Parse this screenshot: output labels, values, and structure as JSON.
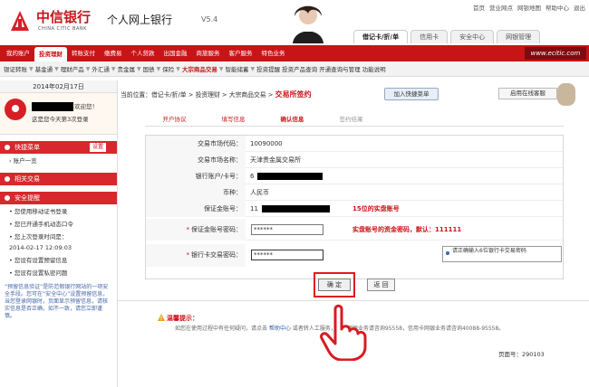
{
  "header": {
    "logo_cn": "中信银行",
    "logo_en": "CHINA CITIC BANK",
    "title": "个人网上银行",
    "version": "V5.4",
    "top_links": [
      "首页",
      "营业网点",
      "网银地图",
      "帮助中心",
      "退出"
    ],
    "top_tabs": [
      "借记卡/折/单",
      "信用卡",
      "安全中心",
      "网银管理"
    ]
  },
  "nav": {
    "items": [
      "我的账户",
      "投资理财",
      "转账支付",
      "缴费易",
      "个人贷款",
      "出国金融",
      "商旅服务",
      "客户服务",
      "特色业务"
    ],
    "active": "投资理财",
    "url": "www.ecitic.com"
  },
  "subnav": {
    "items": [
      "银证转账",
      "基金通",
      "理财产品",
      "外汇通",
      "贵金属",
      "国债",
      "保险",
      "大宗商品交易",
      "智能储蓄",
      "投资提醒",
      "投资产品查询",
      "开通查询与管理",
      "功能说明"
    ],
    "active": "大宗商品交易"
  },
  "sidebar": {
    "date": "2014年02月17日",
    "welcome": "欢迎您！",
    "visits": "这是您今天第3次登录",
    "quick_menu": "快捷菜单",
    "setting": "设置",
    "account": "账户一览",
    "related": "相关交易",
    "security": "安全提醒",
    "security_items": [
      "您使用移动证书登录",
      "您已开通手机动态口令",
      "您上次登录时间是：",
      "2014-02-17 12:09:03",
      "您设有设置预留信息",
      "您设有设置私密问题"
    ],
    "note": "“预留信息验证”是防范假银行网站的一项安全手段。您可在“安全中心”设置预留信息，当您登录网银时，页面显示预留信息，请核实信息是否正确，如不一致，请您立即谨慎。"
  },
  "breadcrumb": {
    "prefix": "当前位置：借记卡/折/单 > 投资理财 > 大宗商品交易 >",
    "current": "交易所签约",
    "add": "加入快捷菜单",
    "service": "启用在线客服"
  },
  "steps": [
    "开户协议",
    "填写信息",
    "确认信息",
    "签约结果"
  ],
  "form": {
    "rows": [
      {
        "label": "交易市场代码：",
        "value": "10090000"
      },
      {
        "label": "交易市场名称：",
        "value": "天津贵金属交易所"
      },
      {
        "label": "银行账户/卡号：",
        "value": "6"
      },
      {
        "label": "币种：",
        "value": "人民币"
      },
      {
        "label": "保证金账号：",
        "value": "11",
        "tip": "15位的实盘账号"
      },
      {
        "label": "保证金账号密码：",
        "value": "******",
        "tip": "实盘账号的资金密码，默认：111111"
      },
      {
        "label": "银行卡交易密码：",
        "value": "******",
        "hint": "请正确输入6位银行卡交易密码"
      }
    ],
    "confirm": "确 定",
    "back": "返 回"
  },
  "warm_tip": {
    "title": "温馨提示：",
    "text_before": "如您在使用过程中有任何疑问，请点击",
    "link": "帮助中心",
    "text_after": "或者转人工服务，个人网银业务请咨询95558，信用卡网银业务请咨询40088-95558。"
  },
  "page_number": "页面号：290103"
}
